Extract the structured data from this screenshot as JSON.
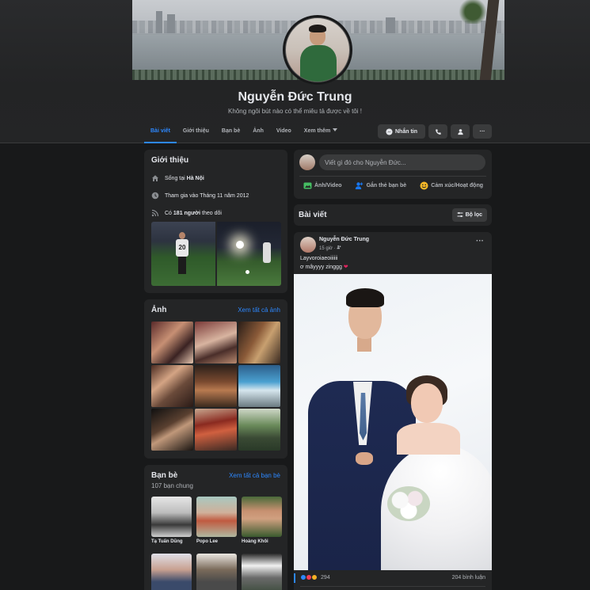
{
  "profile": {
    "name": "Nguyễn Đức Trung",
    "bio": "Không ngôi bút nào có thể miêu tả được về tôi !"
  },
  "nav": {
    "tabs": [
      {
        "label": "Bài viết",
        "active": true
      },
      {
        "label": "Giới thiệu"
      },
      {
        "label": "Bạn bè"
      },
      {
        "label": "Ảnh"
      },
      {
        "label": "Video"
      },
      {
        "label": "Xem thêm"
      }
    ],
    "message_label": "Nhắn tin",
    "more_label": "···"
  },
  "intro": {
    "title": "Giới thiệu",
    "lives_prefix": "Sống tại ",
    "lives_city": "Hà Nội",
    "joined": "Tham gia vào Tháng 11 năm 2012",
    "followers_prefix": "Có ",
    "followers_count": "181 người",
    "followers_suffix": " theo dõi",
    "photo1_number": "20"
  },
  "photos": {
    "title": "Ảnh",
    "see_all": "Xem tất cả ảnh"
  },
  "friends": {
    "title": "Bạn bè",
    "see_all": "Xem tất cả bạn bè",
    "mutual": "107 bạn chung",
    "items": [
      {
        "name": "Tạ Tuấn Dũng"
      },
      {
        "name": "Popo Lee"
      },
      {
        "name": "Hoàng Khôi"
      },
      {
        "name": ""
      },
      {
        "name": ""
      },
      {
        "name": ""
      }
    ]
  },
  "composer": {
    "placeholder": "Viết gì đó cho Nguyễn Đức...",
    "actions": [
      {
        "label": "Ảnh/Video",
        "icon": "photo-video-icon",
        "color": "#45bd62"
      },
      {
        "label": "Gắn thẻ bạn bè",
        "icon": "tag-friends-icon",
        "color": "#1877f2"
      },
      {
        "label": "Cảm xúc/Hoạt động",
        "icon": "feeling-icon",
        "color": "#f7b928"
      }
    ]
  },
  "posts_section": {
    "title": "Bài viết",
    "filter_label": "Bộ lọc"
  },
  "post": {
    "author": "Nguyễn Đức Trung",
    "time": "15 giờ · ",
    "line1": "Layvoroiaeoiiiiii",
    "line2": "ơ mâyyyy zinggg",
    "reactions_count": "294",
    "comments": "204 bình luận"
  },
  "colors": {
    "accent": "#2d88ff",
    "background": "#18191a",
    "panel": "#242526",
    "button": "#3a3b3c"
  }
}
